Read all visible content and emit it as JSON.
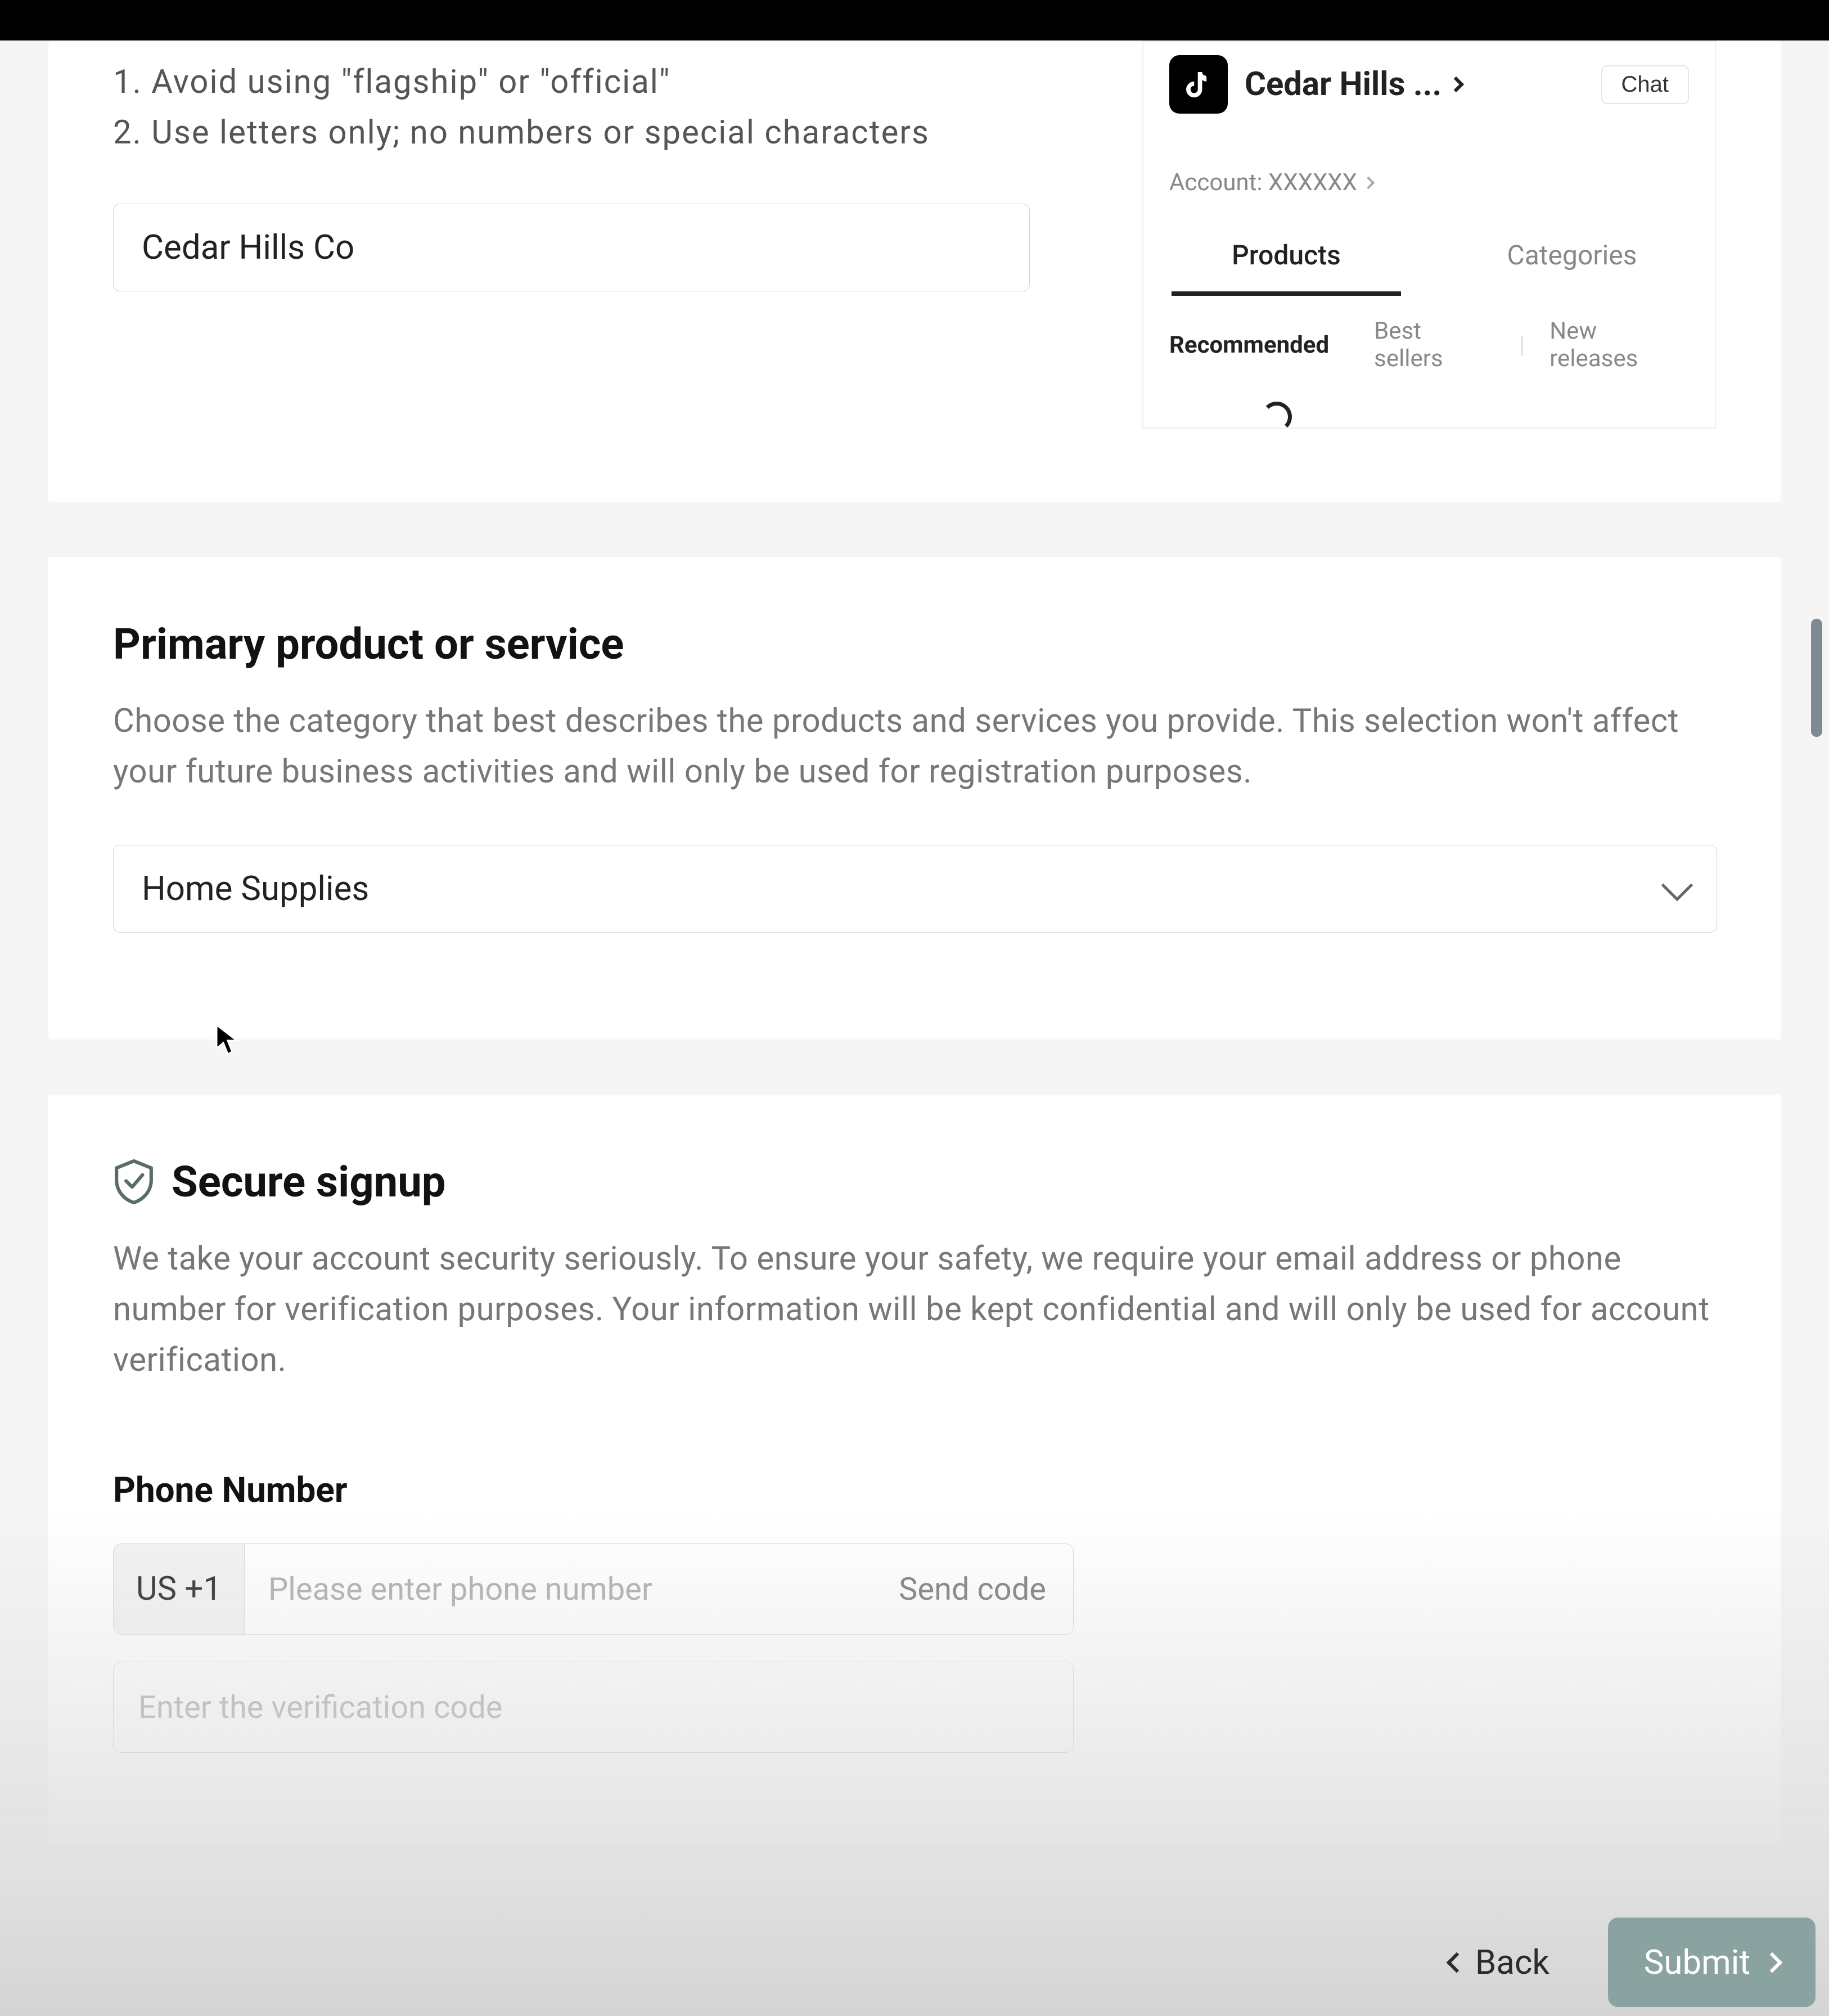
{
  "shop_name": {
    "instructions": [
      "1. Avoid using \"flagship\" or \"official\"",
      "2. Use letters only; no numbers or special characters"
    ],
    "value": "Cedar Hills Co"
  },
  "preview": {
    "shop_title": "Cedar Hills ...",
    "chat_label": "Chat",
    "account_label": "Account: XXXXXX",
    "tabs": {
      "products": "Products",
      "categories": "Categories"
    },
    "filters": {
      "recommended": "Recommended",
      "best_sellers": "Best sellers",
      "new_releases": "New releases"
    }
  },
  "primary_product": {
    "title": "Primary product or service",
    "description": "Choose the category that best describes the products and services you provide. This selection won't affect your future business activities and will only be used for registration purposes.",
    "selected": "Home Supplies"
  },
  "secure_signup": {
    "title": "Secure signup",
    "description": "We take your account security seriously. To ensure your safety, we require your email address or phone number for verification purposes. Your information will be kept confidential and will only be used for account verification.",
    "phone_label": "Phone Number",
    "country_code": "US +1",
    "phone_placeholder": "Please enter phone number",
    "send_code_label": "Send code",
    "verify_placeholder": "Enter the verification code"
  },
  "footer": {
    "back": "Back",
    "submit": "Submit"
  }
}
